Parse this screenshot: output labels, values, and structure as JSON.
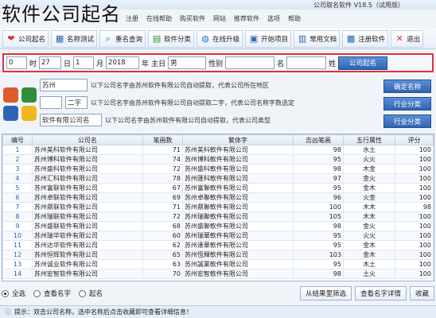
{
  "caption": "软件公司起名",
  "window": {
    "title": "公司取名软件 V18.5（试用版）"
  },
  "menubar": [
    "注册",
    "在线帮助",
    "购买软件",
    "网站",
    "推荐软件",
    "选项",
    "帮助"
  ],
  "toolbar": [
    {
      "label": "公司起名",
      "icon": "heart-icon",
      "glyph": "❤",
      "color": "#d8342f"
    },
    {
      "label": "名称测试",
      "icon": "chart-icon",
      "glyph": "▦",
      "color": "#2f64b2"
    },
    {
      "label": "重名查询",
      "icon": "search-icon",
      "glyph": "⌕",
      "color": "#2f64b2"
    },
    {
      "label": "软件分类",
      "icon": "grid-icon",
      "glyph": "▤",
      "color": "#3c8c3c"
    },
    {
      "label": "在线升级",
      "icon": "globe-icon",
      "glyph": "◍",
      "color": "#1e7fd0"
    },
    {
      "label": "开始项目",
      "icon": "folder-icon",
      "glyph": "▣",
      "color": "#2f64b2"
    },
    {
      "label": "常用文档",
      "icon": "document-icon",
      "glyph": "▥",
      "color": "#2f64b2"
    },
    {
      "label": "注册软件",
      "icon": "register-icon",
      "glyph": "▩",
      "color": "#2f64b2"
    },
    {
      "label": "退出",
      "icon": "close-icon",
      "glyph": "✕",
      "color": "#d8342f"
    }
  ],
  "search": {
    "button_label": "公司起名",
    "surname_label": "姓",
    "name_label": "名",
    "gender_label": "性别",
    "gender_value": "男",
    "zodiac_label": "主日",
    "year_value": "2018",
    "year_label": "年",
    "month_value": "1",
    "month_label": "月",
    "day_value": "27",
    "day_label": "日",
    "hour_value": "0",
    "hour_label": "时"
  },
  "options": {
    "row1_text": "以下公司名字由苏州软件有限公司自动提取，代表公司所在地区",
    "row1_button": "确定名称",
    "row2_select": "二字",
    "row2_text": "以下公司名字由苏州软件有限公司自动提取二字，代表公司名称字数选定",
    "row2_button": "行业分类",
    "row3_field": "软件有限公司名",
    "row3_text": "以下公司名字由苏州软件有限公司自动提取，代表公司类型",
    "row3_button": "行业分类",
    "field1_label": "苏州"
  },
  "table": {
    "columns": [
      "编号",
      "公司名",
      "笔画数",
      "繁体字",
      "吉凶笔画",
      "五行属性",
      "评分"
    ],
    "rows": [
      [
        "1",
        "苏州美科软件有限公司",
        "71",
        "苏州美科軟件有限公司",
        "98",
        "水土",
        "100"
      ],
      [
        "2",
        "苏州博科软件有限公司",
        "74",
        "苏州博科軟件有限公司",
        "95",
        "火火",
        "100"
      ],
      [
        "3",
        "苏州盛科软件有限公司",
        "72",
        "苏州盛科軟件有限公司",
        "98",
        "木金",
        "100"
      ],
      [
        "4",
        "苏州汇科软件有限公司",
        "78",
        "苏州匯科軟件有限公司",
        "97",
        "金火",
        "100"
      ],
      [
        "5",
        "苏州富联软件有限公司",
        "67",
        "苏州富聯軟件有限公司",
        "95",
        "金木",
        "100"
      ],
      [
        "6",
        "苏州卓联软件有限公司",
        "69",
        "苏州卓聯軟件有限公司",
        "96",
        "火金",
        "100"
      ],
      [
        "7",
        "苏州鼎联软件有限公司",
        "71",
        "苏州鼎聯軟件有限公司",
        "100",
        "木木",
        "98"
      ],
      [
        "8",
        "苏州瑞联软件有限公司",
        "72",
        "苏州瑞聯軟件有限公司",
        "105",
        "木木",
        "100"
      ],
      [
        "9",
        "苏州盛联软件有限公司",
        "68",
        "苏州盛聯軟件有限公司",
        "98",
        "金火",
        "100"
      ],
      [
        "10",
        "苏州瑞华软件有限公司",
        "60",
        "苏州瑞華軟件有限公司",
        "95",
        "火火",
        "100"
      ],
      [
        "11",
        "苏州达华软件有限公司",
        "62",
        "苏州達華軟件有限公司",
        "95",
        "金木",
        "100"
      ],
      [
        "12",
        "苏州恒辉软件有限公司",
        "65",
        "苏州恆輝軟件有限公司",
        "103",
        "金木",
        "100"
      ],
      [
        "13",
        "苏州诚业软件有限公司",
        "63",
        "苏州誠業軟件有限公司",
        "95",
        "木土",
        "100"
      ],
      [
        "14",
        "苏州宏智软件有限公司",
        "70",
        "苏州宏智軟件有限公司",
        "98",
        "土火",
        "100"
      ]
    ]
  },
  "footer": {
    "radio1": "全选",
    "radio2": "查看名字",
    "radio3": "起名",
    "btn1": "从结果里筛选",
    "btn2": "查看名字详情",
    "btn3": "收藏"
  },
  "status": "提示：双击公司名称，选中名称后点击收藏即可查看详细信息！"
}
